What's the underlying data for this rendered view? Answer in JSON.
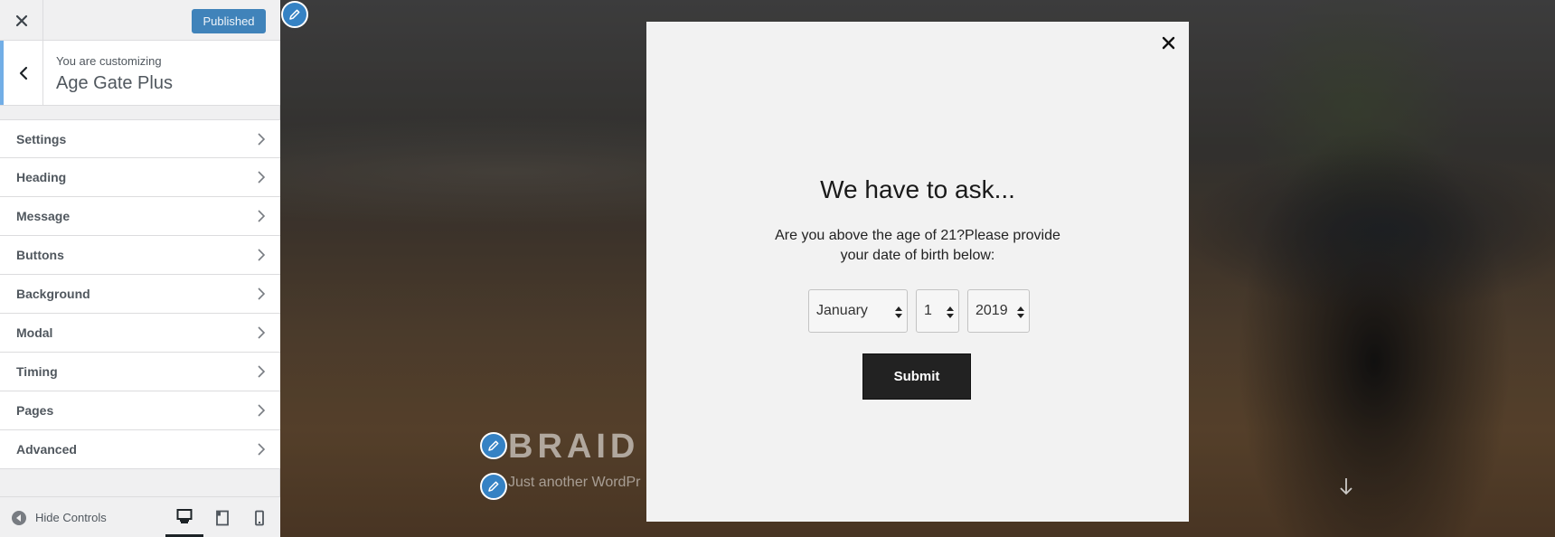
{
  "topbar": {
    "publish_label": "Published"
  },
  "section": {
    "customizing_label": "You are customizing",
    "title": "Age Gate Plus"
  },
  "panels": [
    {
      "label": "Settings"
    },
    {
      "label": "Heading"
    },
    {
      "label": "Message"
    },
    {
      "label": "Buttons"
    },
    {
      "label": "Background"
    },
    {
      "label": "Modal"
    },
    {
      "label": "Timing"
    },
    {
      "label": "Pages"
    },
    {
      "label": "Advanced"
    }
  ],
  "footer": {
    "hide_controls_label": "Hide Controls",
    "devices": [
      "desktop",
      "tablet",
      "mobile"
    ],
    "active_device": "desktop"
  },
  "preview": {
    "site_title": "BRAID V",
    "tagline": "Just another WordPr"
  },
  "modal": {
    "heading": "We have to ask...",
    "message": "Are you above the age of 21?Please provide your date of birth below:",
    "month": "January",
    "day": "1",
    "year": "2019",
    "submit_label": "Submit"
  },
  "colors": {
    "publish_button": "#2271b1",
    "edit_shortcut": "#3582c4",
    "modal_background": "#f2f2f2",
    "submit_button": "#222222"
  },
  "icons": {
    "close": "close-icon",
    "back": "chevron-left-icon",
    "panel": "chevron-right-icon",
    "hide_controls": "collapse-arrow-icon",
    "edit": "pencil-icon",
    "scroll": "arrow-down-icon"
  }
}
